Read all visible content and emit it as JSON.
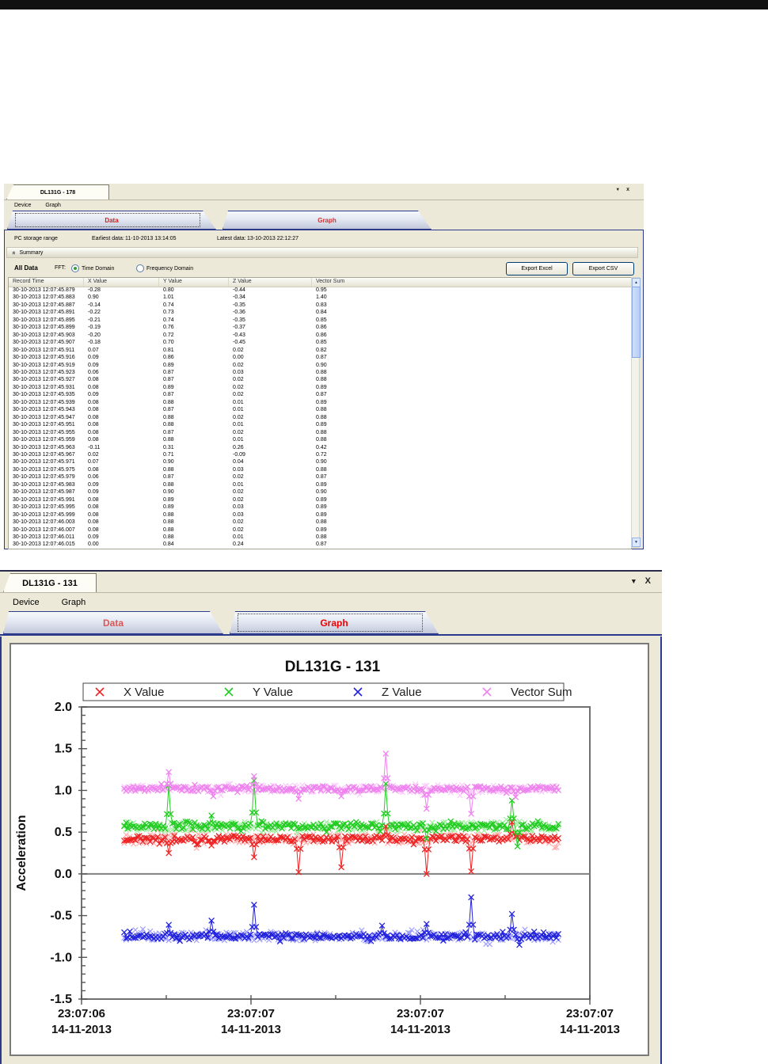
{
  "window1": {
    "tab_title": "DL131G - 178",
    "menu": [
      "Device",
      "Graph"
    ],
    "tabs": {
      "data": "Data",
      "graph": "Graph"
    },
    "window_controls": {
      "dropdown": "▼",
      "close": "x"
    },
    "info": {
      "storage_label": "PC storage range",
      "earliest_label": "Earliest data:",
      "earliest_value": "11-10-2013 13:14:05",
      "latest_label": "Latest data:",
      "latest_value": "13-10-2013 22:12:27"
    },
    "summary_label": "Summary",
    "controls": {
      "all_data": "All Data",
      "fft_label": "FFT:",
      "radio_time": "Time Domain",
      "radio_freq": "Frequency Domain",
      "export_excel": "Export Excel",
      "export_csv": "Export CSV"
    },
    "table": {
      "columns": [
        "Record Time",
        "X Value",
        "Y Value",
        "Z Value",
        "Vector Sum"
      ],
      "rows": [
        [
          "30-10-2013 12:07:45.879",
          "-0.28",
          "0.80",
          "-0.44",
          "0.95"
        ],
        [
          "30-10-2013 12:07:45.883",
          "0.90",
          "1.01",
          "-0.34",
          "1.40"
        ],
        [
          "30-10-2013 12:07:45.887",
          "-0.14",
          "0.74",
          "-0.35",
          "0.83"
        ],
        [
          "30-10-2013 12:07:45.891",
          "-0.22",
          "0.73",
          "-0.36",
          "0.84"
        ],
        [
          "30-10-2013 12:07:45.895",
          "-0.21",
          "0.74",
          "-0.35",
          "0.85"
        ],
        [
          "30-10-2013 12:07:45.899",
          "-0.19",
          "0.76",
          "-0.37",
          "0.86"
        ],
        [
          "30-10-2013 12:07:45.903",
          "-0.20",
          "0.72",
          "-0.43",
          "0.86"
        ],
        [
          "30-10-2013 12:07:45.907",
          "-0.18",
          "0.70",
          "-0.45",
          "0.85"
        ],
        [
          "30-10-2013 12:07:45.911",
          "0.07",
          "0.81",
          "0.02",
          "0.82"
        ],
        [
          "30-10-2013 12:07:45.916",
          "0.09",
          "0.86",
          "0.00",
          "0.87"
        ],
        [
          "30-10-2013 12:07:45.919",
          "0.09",
          "0.89",
          "0.02",
          "0.90"
        ],
        [
          "30-10-2013 12:07:45.923",
          "0.06",
          "0.87",
          "0.03",
          "0.88"
        ],
        [
          "30-10-2013 12:07:45.927",
          "0.08",
          "0.87",
          "0.02",
          "0.88"
        ],
        [
          "30-10-2013 12:07:45.931",
          "0.08",
          "0.89",
          "0.02",
          "0.89"
        ],
        [
          "30-10-2013 12:07:45.935",
          "0.09",
          "0.87",
          "0.02",
          "0.87"
        ],
        [
          "30-10-2013 12:07:45.939",
          "0.08",
          "0.88",
          "0.01",
          "0.89"
        ],
        [
          "30-10-2013 12:07:45.943",
          "0.08",
          "0.87",
          "0.01",
          "0.88"
        ],
        [
          "30-10-2013 12:07:45.947",
          "0.08",
          "0.88",
          "0.02",
          "0.88"
        ],
        [
          "30-10-2013 12:07:45.951",
          "0.08",
          "0.88",
          "0.01",
          "0.89"
        ],
        [
          "30-10-2013 12:07:45.955",
          "0.08",
          "0.87",
          "0.02",
          "0.88"
        ],
        [
          "30-10-2013 12:07:45.959",
          "0.08",
          "0.88",
          "0.01",
          "0.88"
        ],
        [
          "30-10-2013 12:07:45.963",
          "-0.11",
          "0.31",
          "0.26",
          "0.42"
        ],
        [
          "30-10-2013 12:07:45.967",
          "0.02",
          "0.71",
          "-0.09",
          "0.72"
        ],
        [
          "30-10-2013 12:07:45.971",
          "0.07",
          "0.90",
          "0.04",
          "0.90"
        ],
        [
          "30-10-2013 12:07:45.975",
          "0.08",
          "0.88",
          "0.03",
          "0.88"
        ],
        [
          "30-10-2013 12:07:45.979",
          "0.06",
          "0.87",
          "0.02",
          "0.87"
        ],
        [
          "30-10-2013 12:07:45.983",
          "0.09",
          "0.88",
          "0.01",
          "0.89"
        ],
        [
          "30-10-2013 12:07:45.987",
          "0.09",
          "0.90",
          "0.02",
          "0.90"
        ],
        [
          "30-10-2013 12:07:45.991",
          "0.08",
          "0.89",
          "0.02",
          "0.89"
        ],
        [
          "30-10-2013 12:07:45.995",
          "0.08",
          "0.89",
          "0.03",
          "0.89"
        ],
        [
          "30-10-2013 12:07:45.999",
          "0.08",
          "0.88",
          "0.03",
          "0.89"
        ],
        [
          "30-10-2013 12:07:46.003",
          "0.08",
          "0.88",
          "0.02",
          "0.88"
        ],
        [
          "30-10-2013 12:07:46.007",
          "0.08",
          "0.88",
          "0.02",
          "0.89"
        ],
        [
          "30-10-2013 12:07:46.011",
          "0.09",
          "0.88",
          "0.01",
          "0.88"
        ],
        [
          "30-10-2013 12:07:46.015",
          "0.00",
          "0.84",
          "0.24",
          "0.87"
        ]
      ]
    }
  },
  "window2": {
    "tab_title": "DL131G - 131",
    "menu": [
      "Device",
      "Graph"
    ],
    "tabs": {
      "data": "Data",
      "graph": "Graph"
    },
    "window_controls": {
      "dropdown": "▼",
      "close": "X"
    }
  },
  "chart_data": {
    "type": "scatter-line",
    "title": "DL131G - 131",
    "ylabel": "Acceleration",
    "ylim": [
      -1.5,
      2.0
    ],
    "ytick_step": 0.5,
    "ytick_labels": [
      "2.0",
      "1.5",
      "1.0",
      "0.5",
      "0.0",
      "-0.5",
      "-1.0",
      "-1.5"
    ],
    "y_minor_step": 0.1,
    "x_tick_labels": [
      [
        "23:07:06",
        "14-11-2013"
      ],
      [
        "23:07:07",
        "14-11-2013"
      ],
      [
        "23:07:07",
        "14-11-2013"
      ],
      [
        "23:07:07",
        "14-11-2013"
      ]
    ],
    "legend_position": "top",
    "grid": false,
    "marker": "x",
    "points_per_series": 235,
    "data_span": [
      0.084,
      0.938
    ],
    "series": [
      {
        "name": "X Value",
        "color": "#ee2222",
        "light": "#ffaaaa",
        "baseline": 0.42,
        "noise": 0.035,
        "spikes": [
          {
            "t": 0.102,
            "v": 0.25
          },
          {
            "t": 0.2,
            "v": 0.34
          },
          {
            "t": 0.301,
            "v": 0.2
          },
          {
            "t": 0.401,
            "v": 0.02
          },
          {
            "t": 0.502,
            "v": 0.08
          },
          {
            "t": 0.602,
            "v": 0.57
          },
          {
            "t": 0.695,
            "v": 0.0
          },
          {
            "t": 0.799,
            "v": 0.03
          },
          {
            "t": 0.894,
            "v": 0.62
          }
        ]
      },
      {
        "name": "Y Value",
        "color": "#22cc22",
        "light": "#a0eea0",
        "baseline": 0.57,
        "noise": 0.035,
        "spikes": [
          {
            "t": 0.102,
            "v": 1.06
          },
          {
            "t": 0.2,
            "v": 0.7
          },
          {
            "t": 0.301,
            "v": 1.12
          },
          {
            "t": 0.602,
            "v": 1.08
          },
          {
            "t": 0.695,
            "v": 0.42
          },
          {
            "t": 0.894,
            "v": 0.88
          },
          {
            "t": 0.905,
            "v": 0.33
          }
        ]
      },
      {
        "name": "Z Value",
        "color": "#2222dd",
        "light": "#9f9fff",
        "baseline": -0.75,
        "noise": 0.03,
        "spikes": [
          {
            "t": 0.102,
            "v": -0.61
          },
          {
            "t": 0.2,
            "v": -0.56
          },
          {
            "t": 0.301,
            "v": -0.37
          },
          {
            "t": 0.593,
            "v": -0.62
          },
          {
            "t": 0.695,
            "v": -0.6
          },
          {
            "t": 0.799,
            "v": -0.28
          },
          {
            "t": 0.894,
            "v": -0.48
          },
          {
            "t": 0.909,
            "v": -0.85
          }
        ]
      },
      {
        "name": "Vector Sum",
        "color": "#ee82ee",
        "light": "#fac8fa",
        "baseline": 1.02,
        "noise": 0.028,
        "spikes": [
          {
            "t": 0.102,
            "v": 1.22
          },
          {
            "t": 0.206,
            "v": 0.93
          },
          {
            "t": 0.301,
            "v": 1.17
          },
          {
            "t": 0.401,
            "v": 0.9
          },
          {
            "t": 0.502,
            "v": 0.93
          },
          {
            "t": 0.602,
            "v": 1.44
          },
          {
            "t": 0.695,
            "v": 0.78
          },
          {
            "t": 0.799,
            "v": 0.72
          },
          {
            "t": 0.903,
            "v": 0.92
          }
        ]
      }
    ]
  }
}
